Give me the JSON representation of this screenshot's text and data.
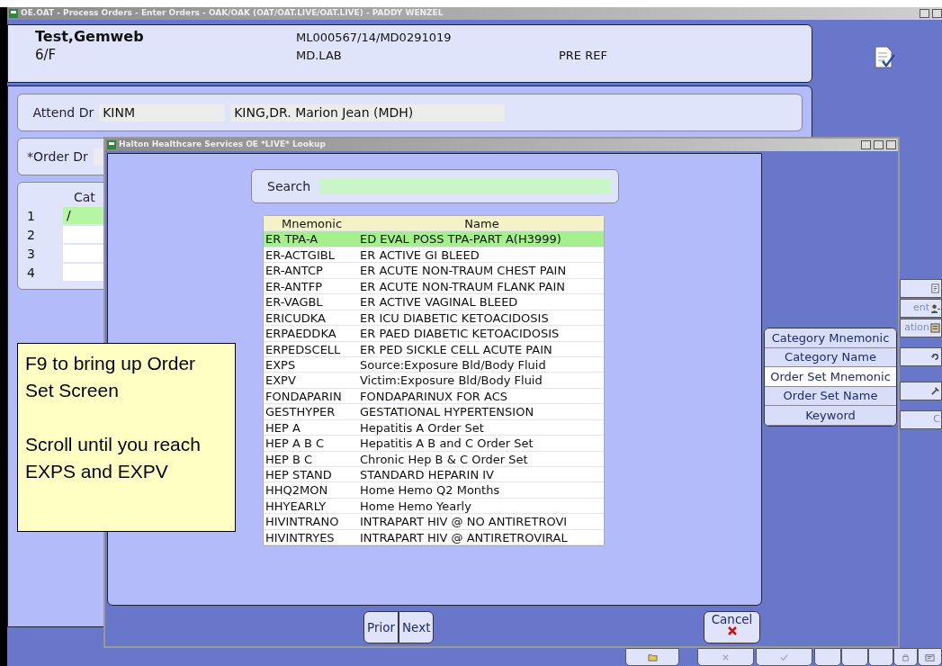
{
  "window": {
    "title": "OE.OAT - Process Orders - Enter Orders - OAK/OAK (OAT/OAT.LIVE/OAT.LIVE) - PADDY WENZEL"
  },
  "patient": {
    "name": "Test,Gemweb",
    "age_sex": "6/F",
    "account": "ML000567/14/MD0291019",
    "location": "MD.LAB",
    "status": "PRE REF"
  },
  "attend_dr": {
    "label": "Attend Dr",
    "mnemonic": "KINM",
    "name": "KING,DR. Marion Jean (MDH)"
  },
  "order_dr": {
    "label": "*Order Dr"
  },
  "category_grid": {
    "header": "Cat",
    "rows": [
      {
        "number": "1",
        "value": "/",
        "selected": true
      },
      {
        "number": "2",
        "value": "",
        "selected": false
      },
      {
        "number": "3",
        "value": "",
        "selected": false
      },
      {
        "number": "4",
        "value": "",
        "selected": false
      }
    ]
  },
  "side_labels": [
    "ent",
    "ation",
    "C"
  ],
  "lookup": {
    "title": "Halton Healthcare Services OE *LIVE* Lookup",
    "search": {
      "label": "Search"
    },
    "table": {
      "columns": [
        "Mnemonic",
        "Name"
      ],
      "rows": [
        {
          "mnemonic": "ER TPA-A",
          "name": "ED EVAL POSS TPA-PART A(H3999)",
          "selected": true
        },
        {
          "mnemonic": "ER-ACTGIBL",
          "name": "ER ACTIVE GI BLEED",
          "selected": false
        },
        {
          "mnemonic": "ER-ANTCP",
          "name": "ER ACUTE NON-TRAUM CHEST PAIN",
          "selected": false
        },
        {
          "mnemonic": "ER-ANTFP",
          "name": "ER ACUTE NON-TRAUM FLANK PAIN",
          "selected": false
        },
        {
          "mnemonic": "ER-VAGBL",
          "name": "ER ACTIVE VAGINAL BLEED",
          "selected": false
        },
        {
          "mnemonic": "ERICUDKA",
          "name": "ER ICU DIABETIC KETOACIDOSIS",
          "selected": false
        },
        {
          "mnemonic": "ERPAEDDKA",
          "name": "ER PAED DIABETIC KETOACIDOSIS",
          "selected": false
        },
        {
          "mnemonic": "ERPEDSCELL",
          "name": "ER PED SICKLE CELL ACUTE PAIN",
          "selected": false
        },
        {
          "mnemonic": "EXPS",
          "name": "Source:Exposure Bld/Body Fluid",
          "selected": false
        },
        {
          "mnemonic": "EXPV",
          "name": "Victim:Exposure Bld/Body Fluid",
          "selected": false
        },
        {
          "mnemonic": "FONDAPARIN",
          "name": "FONDAPARINUX FOR ACS",
          "selected": false
        },
        {
          "mnemonic": "GESTHYPER",
          "name": "GESTATIONAL HYPERTENSION",
          "selected": false
        },
        {
          "mnemonic": "HEP A",
          "name": "Hepatitis A Order Set",
          "selected": false
        },
        {
          "mnemonic": "HEP A B C",
          "name": "Hepatitis A B and C Order Set",
          "selected": false
        },
        {
          "mnemonic": "HEP B C",
          "name": "Chronic Hep B & C Order Set",
          "selected": false
        },
        {
          "mnemonic": "HEP STAND",
          "name": "STANDARD HEPARIN IV",
          "selected": false
        },
        {
          "mnemonic": "HHQ2MON",
          "name": "Home Hemo Q2 Months",
          "selected": false
        },
        {
          "mnemonic": "HHYEARLY",
          "name": "Home Hemo Yearly",
          "selected": false
        },
        {
          "mnemonic": "HIVINTRANO",
          "name": "INTRAPART HIV @ NO ANTIRETROVI",
          "selected": false
        },
        {
          "mnemonic": "HIVINTRYES",
          "name": "INTRAPART HIV @ ANTIRETROVIRAL",
          "selected": false
        }
      ]
    },
    "sort_options": [
      {
        "label": "Category Mnemonic",
        "selected": false
      },
      {
        "label": "Category Name",
        "selected": false
      },
      {
        "label": "Order Set Mnemonic",
        "selected": true
      },
      {
        "label": "Order Set Name",
        "selected": false
      },
      {
        "label": "Keyword",
        "selected": false
      }
    ],
    "paging": [
      "Prior",
      "Next"
    ],
    "cancel": "Cancel"
  },
  "note": {
    "paragraphs": [
      "F9 to bring up Order Set Screen",
      "Scroll until you reach EXPS and EXPV"
    ]
  }
}
